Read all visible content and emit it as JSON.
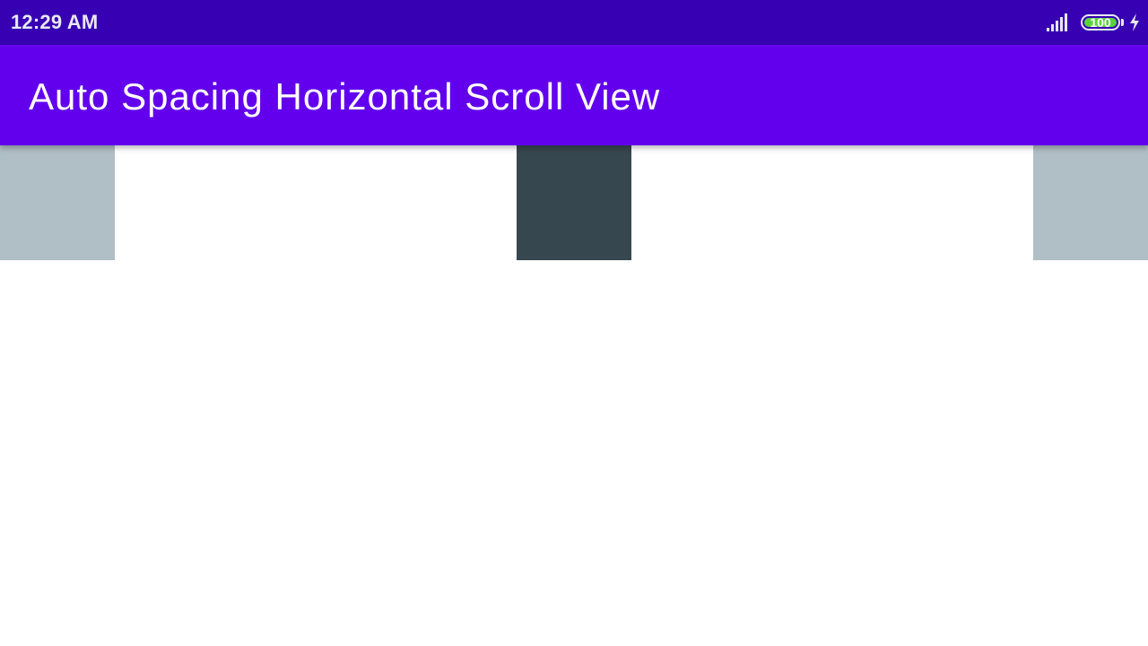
{
  "status_bar": {
    "time": "12:29 AM",
    "battery_level": "100",
    "icons": [
      "signal-icon",
      "battery-icon",
      "charging-icon"
    ],
    "color": "#3700b3"
  },
  "app_bar": {
    "title": "Auto Spacing Horizontal Scroll View",
    "color": "#6200ee"
  },
  "scroll_view": {
    "items": [
      {
        "name": "item-left",
        "color": "#b0bec5"
      },
      {
        "name": "item-center",
        "color": "#37474f"
      },
      {
        "name": "item-right",
        "color": "#b0bec5"
      }
    ]
  }
}
